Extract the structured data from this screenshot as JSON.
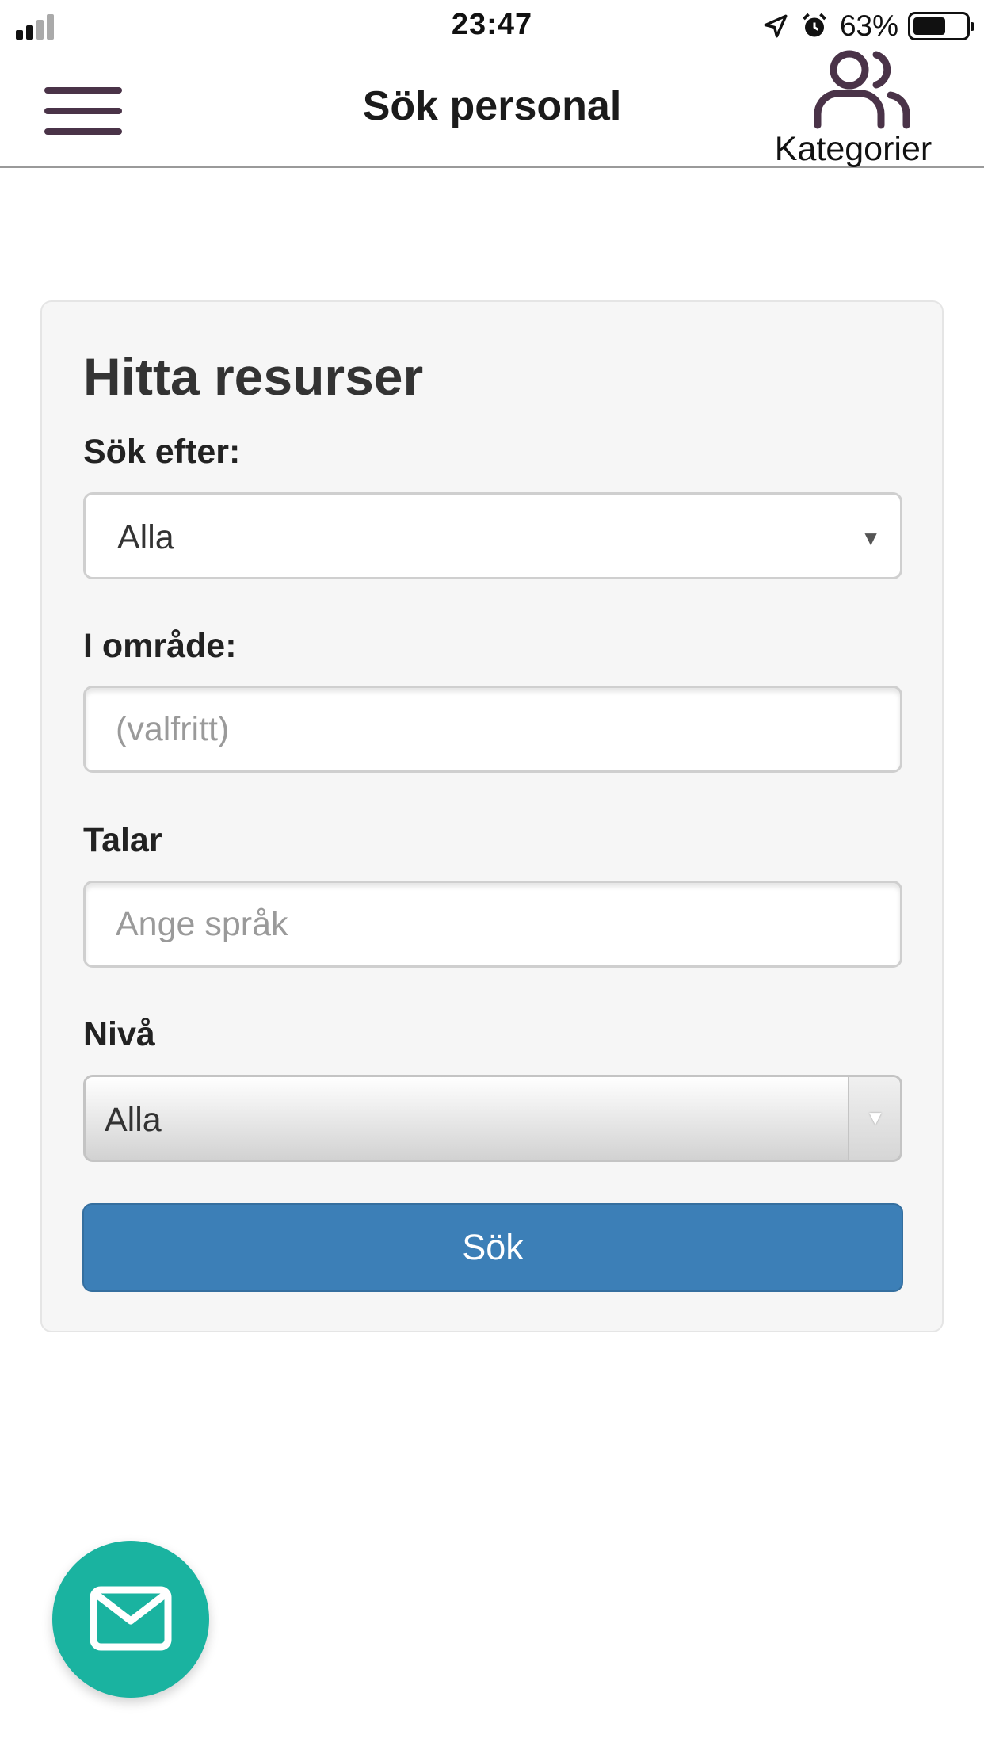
{
  "status_bar": {
    "time": "23:47",
    "battery_percent": "63%",
    "battery_level": 0.63,
    "icons": [
      "signal-icon",
      "location-arrow-icon",
      "alarm-icon",
      "battery-icon"
    ]
  },
  "header": {
    "title": "Sök personal",
    "menu_icon": "hamburger-menu-icon",
    "categories": {
      "label": "Kategorier",
      "icon": "users-icon"
    }
  },
  "form": {
    "title": "Hitta resurser",
    "search_for": {
      "label": "Sök efter:",
      "value": "Alla"
    },
    "area": {
      "label": "I område:",
      "placeholder": "(valfritt)"
    },
    "speaks": {
      "label": "Talar",
      "placeholder": "Ange språk"
    },
    "level": {
      "label": "Nivå",
      "value": "Alla"
    },
    "submit_label": "Sök"
  },
  "fab": {
    "icon": "mail-icon"
  },
  "colors": {
    "accent_purple": "#4a3348",
    "button_blue": "#3c7fb7",
    "fab_teal": "#1ab3a0",
    "card_bg": "#f6f6f6"
  }
}
